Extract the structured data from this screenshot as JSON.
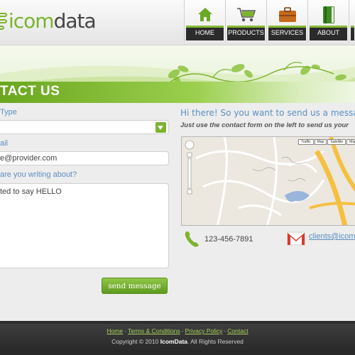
{
  "brand": {
    "prefix": "icom",
    "suffix": "data"
  },
  "nav": [
    {
      "label": "HOME",
      "icon": "home-icon"
    },
    {
      "label": "PRODUCTS",
      "icon": "shopping-cart-icon"
    },
    {
      "label": "SERVICES",
      "icon": "briefcase-icon"
    },
    {
      "label": "ABOUT",
      "icon": "book-icon"
    }
  ],
  "page_title": "TACT US",
  "form": {
    "type_label": "Type",
    "type_value": "",
    "email_label": "ail",
    "email_value": "e@provider.com",
    "message_label": "are you writing about?",
    "message_value": "ted to say HELLO",
    "send_label": "send message"
  },
  "info": {
    "greeting": "Hi there! So you want to send us a messa",
    "subgreeting": "Just use the contact form on the left to send us your",
    "map_types": [
      "Traffic",
      "Map",
      "Satellite",
      "Map"
    ],
    "phone": "123-456-7891",
    "email": "clients@icomd"
  },
  "footer": {
    "links": [
      "Home",
      "Terms & Conditions",
      "Privacy Policy",
      "Contact"
    ],
    "copyright_prefix": "Copyright © 2010 ",
    "copyright_brand": "IcomData",
    "copyright_suffix": ". All Rights Reserved"
  },
  "colors": {
    "accent_green": "#7ab32e",
    "link_blue": "#5b8ec1",
    "footer_dark": "#2b2b2b"
  }
}
